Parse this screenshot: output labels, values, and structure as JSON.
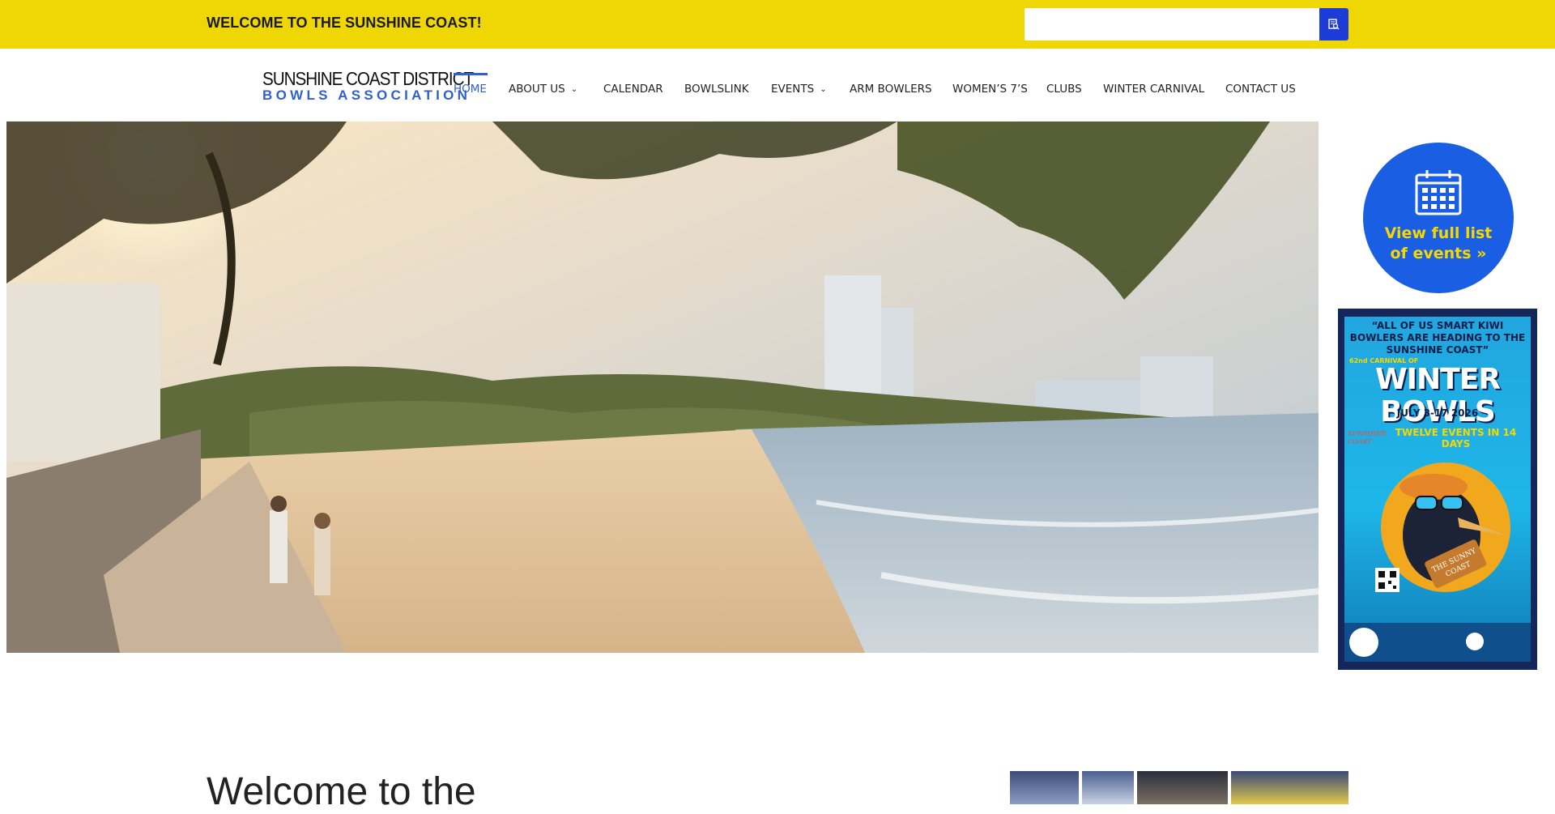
{
  "topbar": {
    "welcome_text": "WELCOME TO THE SUNSHINE COAST!",
    "search_placeholder": "",
    "search_value": ""
  },
  "logo": {
    "line1": "SUNSHINE COAST DISTRICT",
    "line2": "BOWLS ASSOCIATION"
  },
  "nav": {
    "items": [
      {
        "label": "HOME",
        "active": true,
        "dropdown": false
      },
      {
        "label": "ABOUT US",
        "active": false,
        "dropdown": true
      },
      {
        "label": "CALENDAR",
        "active": false,
        "dropdown": false
      },
      {
        "label": "BOWLSLINK",
        "active": false,
        "dropdown": false
      },
      {
        "label": "EVENTS",
        "active": false,
        "dropdown": true
      },
      {
        "label": "ARM BOWLERS",
        "active": false,
        "dropdown": false
      },
      {
        "label": "WOMEN’S 7’S",
        "active": false,
        "dropdown": false
      },
      {
        "label": "CLUBS",
        "active": false,
        "dropdown": false
      },
      {
        "label": "WINTER CARNIVAL",
        "active": false,
        "dropdown": false
      },
      {
        "label": "CONTACT US",
        "active": false,
        "dropdown": false
      }
    ]
  },
  "sidebar": {
    "calendar_cta": "View full list of events »",
    "poster": {
      "quote": "“ALL OF US SMART KIWI BOWLERS ARE HEADING TO THE SUNSHINE COAST”",
      "prefix": "62nd CARNIVAL OF",
      "title": "WINTER BOWLS",
      "dates": "JULY 3-17 2026",
      "subtitle": "TWELVE EVENTS IN 14 DAYS",
      "side_text": "SUNSHINE COAST",
      "badge": "THE SUNNY COAST"
    }
  },
  "main": {
    "heading": "Welcome to the"
  },
  "colors": {
    "topbar": "#efd705",
    "accent_blue": "#2f5fd0",
    "search_button": "#1d3bd6",
    "calendar_circle": "#1a5fe3",
    "cta_text": "#f5d800"
  },
  "icons": {
    "search": "search-icon",
    "calendar": "calendar-icon",
    "dropdown": "chevron-down-icon"
  }
}
